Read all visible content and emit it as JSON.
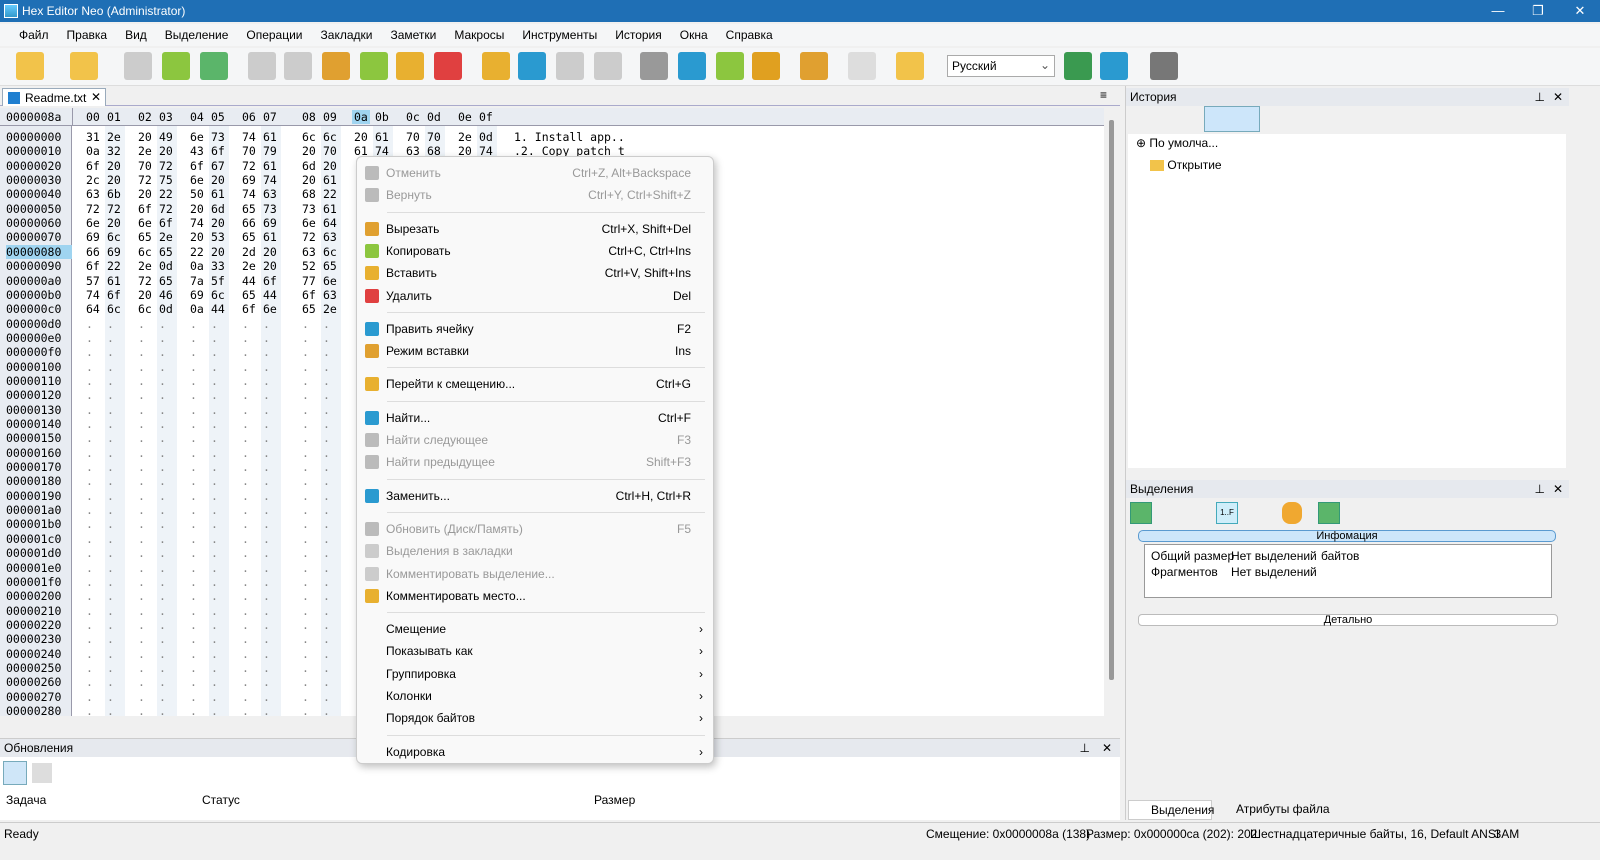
{
  "window": {
    "title": "Hex Editor Neo (Administrator)"
  },
  "menubar": [
    "Файл",
    "Правка",
    "Вид",
    "Выделение",
    "Операции",
    "Закладки",
    "Заметки",
    "Макросы",
    "Инструменты",
    "История",
    "Окна",
    "Справка"
  ],
  "toolbar": {
    "language": "Русский"
  },
  "tab": {
    "label": "Readme.txt"
  },
  "hex": {
    "current_offset": "0000008a",
    "columns": [
      "00",
      "01",
      "02",
      "03",
      "04",
      "05",
      "06",
      "07",
      "08",
      "09",
      "0a",
      "0b",
      "0c",
      "0d",
      "0e",
      "0f"
    ],
    "rows": [
      {
        "o": "00000000",
        "b": [
          "31",
          "2e",
          "20",
          "49",
          "6e",
          "73",
          "74",
          "61",
          "6c",
          "6c",
          "20",
          "61",
          "70",
          "70",
          "2e",
          "0d"
        ],
        "t": "1. Install app.."
      },
      {
        "o": "00000010",
        "b": [
          "0a",
          "32",
          "2e",
          "20",
          "43",
          "6f",
          "70",
          "79",
          "20",
          "70",
          "61",
          "74",
          "63",
          "68",
          "20",
          "74"
        ],
        "t": ".2. Copy patch t"
      },
      {
        "o": "00000020",
        "b": [
          "6f",
          "20",
          "70",
          "72",
          "6f",
          "67",
          "72",
          "61",
          "6d",
          "20"
        ]
      },
      {
        "o": "00000030",
        "b": [
          "2c",
          "20",
          "72",
          "75",
          "6e",
          "20",
          "69",
          "74",
          "20",
          "61"
        ]
      },
      {
        "o": "00000040",
        "b": [
          "63",
          "6b",
          "20",
          "22",
          "50",
          "61",
          "74",
          "63",
          "68",
          "22"
        ]
      },
      {
        "o": "00000050",
        "b": [
          "72",
          "72",
          "6f",
          "72",
          "20",
          "6d",
          "65",
          "73",
          "73",
          "61"
        ]
      },
      {
        "o": "00000060",
        "b": [
          "6e",
          "20",
          "6e",
          "6f",
          "74",
          "20",
          "66",
          "69",
          "6e",
          "64"
        ]
      },
      {
        "o": "00000070",
        "b": [
          "69",
          "6c",
          "65",
          "2e",
          "20",
          "53",
          "65",
          "61",
          "72",
          "63"
        ]
      },
      {
        "o": "00000080",
        "b": [
          "66",
          "69",
          "6c",
          "65",
          "22",
          "20",
          "2d",
          "20",
          "63",
          "6c"
        ]
      },
      {
        "o": "00000090",
        "b": [
          "6f",
          "22",
          "2e",
          "0d",
          "0a",
          "33",
          "2e",
          "20",
          "52",
          "65"
        ]
      },
      {
        "o": "000000a0",
        "b": [
          "57",
          "61",
          "72",
          "65",
          "7a",
          "5f",
          "44",
          "6f",
          "77",
          "6e"
        ]
      },
      {
        "o": "000000b0",
        "b": [
          "74",
          "6f",
          "20",
          "46",
          "69",
          "6c",
          "65",
          "44",
          "6f",
          "63"
        ]
      },
      {
        "o": "000000c0",
        "b": [
          "64",
          "6c",
          "6c",
          "0d",
          "0a",
          "44",
          "6f",
          "6e",
          "65",
          "2e"
        ]
      }
    ],
    "empty_rows": [
      "000000d0",
      "000000e0",
      "000000f0",
      "00000100",
      "00000110",
      "00000120",
      "00000130",
      "00000140",
      "00000150",
      "00000160",
      "00000170",
      "00000180",
      "00000190",
      "000001a0",
      "000001b0",
      "000001c0",
      "000001d0",
      "000001e0",
      "000001f0",
      "00000200",
      "00000210",
      "00000220",
      "00000230",
      "00000240",
      "00000250",
      "00000260",
      "00000270",
      "00000280"
    ]
  },
  "context_menu": [
    {
      "label": "Отменить",
      "shortcut": "Ctrl+Z, Alt+Backspace",
      "disabled": true,
      "icon": "undo-icon",
      "color": "#bbb"
    },
    {
      "label": "Вернуть",
      "shortcut": "Ctrl+Y, Ctrl+Shift+Z",
      "disabled": true,
      "icon": "redo-icon",
      "color": "#bbb",
      "sep": true
    },
    {
      "label": "Вырезать",
      "shortcut": "Ctrl+X, Shift+Del",
      "icon": "scissors-icon",
      "color": "#e0a030"
    },
    {
      "label": "Копировать",
      "shortcut": "Ctrl+C, Ctrl+Ins",
      "icon": "copy-icon",
      "color": "#8cc63f"
    },
    {
      "label": "Вставить",
      "shortcut": "Ctrl+V, Shift+Ins",
      "icon": "paste-icon",
      "color": "#e8b030"
    },
    {
      "label": "Удалить",
      "shortcut": "Del",
      "icon": "eraser-icon",
      "color": "#e04040",
      "sep": true
    },
    {
      "label": "Править ячейку",
      "shortcut": "F2",
      "icon": "pencil-icon",
      "color": "#2a9ad0"
    },
    {
      "label": "Режим вставки",
      "shortcut": "Ins",
      "icon": "insert-mode-icon",
      "color": "#e0a030",
      "sep": true
    },
    {
      "label": "Перейти к смещению...",
      "shortcut": "Ctrl+G",
      "icon": "goto-icon",
      "color": "#e8b030",
      "sep": true
    },
    {
      "label": "Найти...",
      "shortcut": "Ctrl+F",
      "icon": "find-icon",
      "color": "#2a9ad0"
    },
    {
      "label": "Найти следующее",
      "shortcut": "F3",
      "disabled": true,
      "icon": "find-next-icon",
      "color": "#bbb"
    },
    {
      "label": "Найти предыдущее",
      "shortcut": "Shift+F3",
      "disabled": true,
      "icon": "find-prev-icon",
      "color": "#bbb",
      "sep": true
    },
    {
      "label": "Заменить...",
      "shortcut": "Ctrl+H, Ctrl+R",
      "icon": "replace-icon",
      "color": "#2a9ad0",
      "sep": true
    },
    {
      "label": "Обновить (Диск/Память)",
      "shortcut": "F5",
      "disabled": true,
      "icon": "refresh-icon",
      "color": "#bbb"
    },
    {
      "label": "Выделения в закладки",
      "shortcut": "",
      "disabled": true,
      "icon": "bookmark-icon",
      "color": "#ccc"
    },
    {
      "label": "Комментировать выделение...",
      "shortcut": "",
      "disabled": true,
      "icon": "comment-icon",
      "color": "#ccc"
    },
    {
      "label": "Комментировать место...",
      "shortcut": "",
      "icon": "comment-place-icon",
      "color": "#e8b030",
      "sep": true
    },
    {
      "label": "Смещение",
      "submenu": true
    },
    {
      "label": "Показывать как",
      "submenu": true
    },
    {
      "label": "Группировка",
      "submenu": true
    },
    {
      "label": "Колонки",
      "submenu": true
    },
    {
      "label": "Порядок байтов",
      "submenu": true,
      "sep": true
    },
    {
      "label": "Кодировка",
      "submenu": true
    }
  ],
  "history_panel": {
    "title": "История",
    "tree": [
      "По умолча...",
      "Открытие"
    ]
  },
  "selections_panel": {
    "title": "Выделения",
    "info_header": "Инфомация",
    "rows": [
      [
        "Общий размер",
        "Нет выделений",
        "байтов"
      ],
      [
        "Фрагментов",
        "Нет выделений",
        ""
      ]
    ],
    "detail_button": "Детально",
    "tabs": [
      "Выделения",
      "Атрибуты файла"
    ]
  },
  "updates_panel": {
    "title": "Обновления",
    "columns": [
      "Задача",
      "Статус",
      "Размер"
    ]
  },
  "statusbar": {
    "ready": "Ready",
    "offset": "Смещение: 0x0000008a (138)",
    "size": "Размер: 0x000000ca (202): 202",
    "mode": "Шестнадцатеричные байты, 16, Default ANSI",
    "ins": "ЗАМ"
  }
}
